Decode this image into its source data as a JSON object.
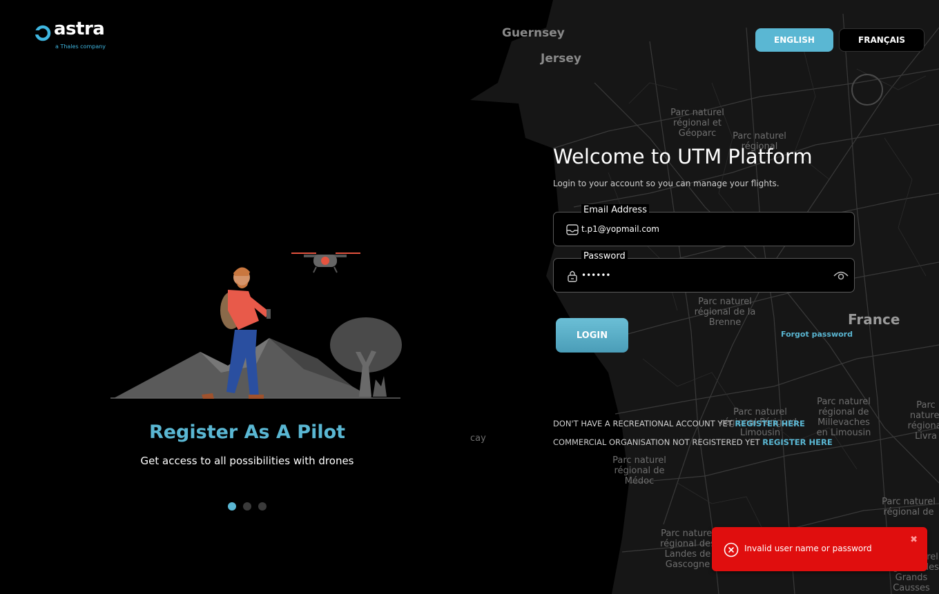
{
  "brand": {
    "name": "astra",
    "tagline": "a Thales company",
    "accent": "#5ab7d3"
  },
  "language": {
    "english_label": "ENGLISH",
    "french_label": "FRANÇAIS",
    "active": "ENGLISH"
  },
  "carousel": {
    "title": "Register As A Pilot",
    "description": "Get access to all possibilities with drones",
    "slide_count": 3,
    "active_index": 0
  },
  "login": {
    "heading": "Welcome to UTM Platform",
    "subheading": "Login to your account so you can manage your flights.",
    "email_label": "Email Address",
    "email_value": "t.p1@yopmail.com",
    "password_label": "Password",
    "password_value": "••••••",
    "login_button": "LOGIN",
    "forgot_password": "Forgot password"
  },
  "registration": {
    "recreational_text": "DON'T HAVE A RECREATIONAL ACCOUNT YET",
    "recreational_link": "REGISTER HERE",
    "commercial_text": "COMMERCIAL ORGANISATION NOT REGISTERED YET",
    "commercial_link": "REGISTER HERE"
  },
  "toast": {
    "message": "Invalid user name or password",
    "color": "#e00e0e"
  },
  "map_labels": {
    "guernsey": "Guernsey",
    "jersey": "Jersey",
    "france": "France",
    "park_1": "Parc naturel régional et Géoparc",
    "park_2": "Parc naturel régional",
    "park_3": "Parc naturel régional de la Brenne",
    "park_4": "Parc naturel régional de Millevaches en Limousin",
    "park_5": "Parc naturel régional Périgord-Limousin",
    "park_6": "Parc naturel régional de Médoc",
    "park_7": "Parc naturel régional des Landes de Gascogne",
    "park_8": "Parc naturel régional de",
    "park_9": "Parc naturel régional des Grands Causses",
    "park_10": "Parc naturel régional Livra",
    "cay": "cay"
  }
}
